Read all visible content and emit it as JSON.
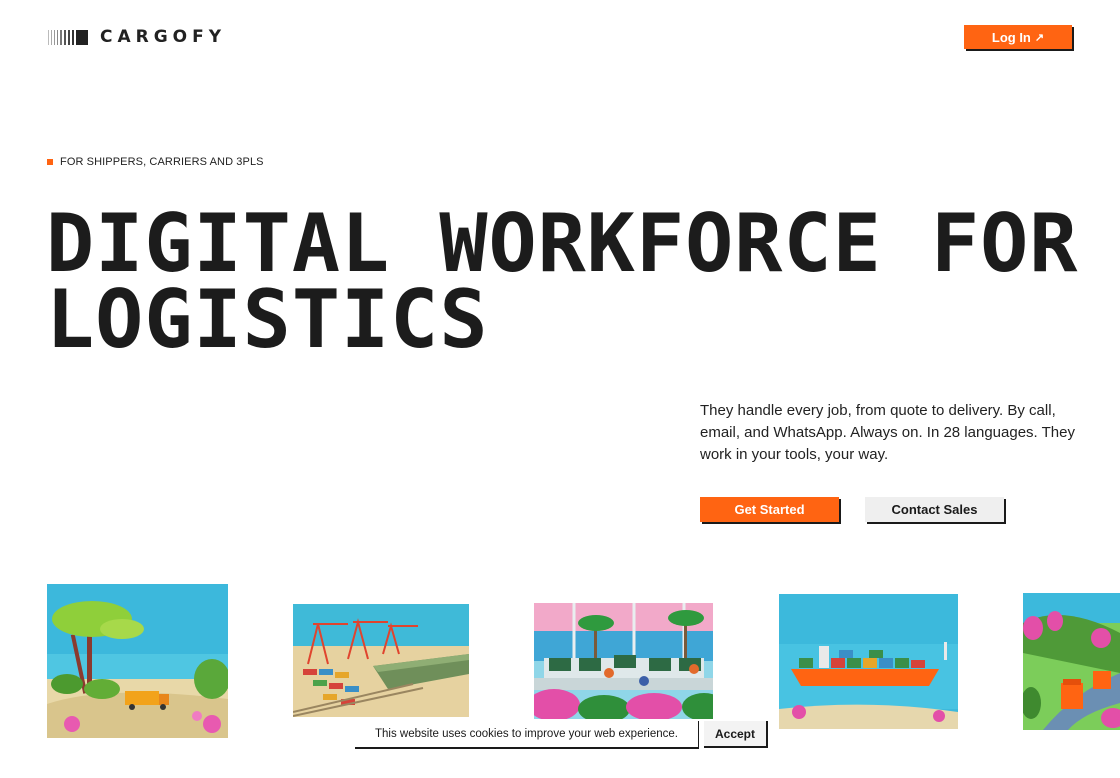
{
  "header": {
    "logo_text": "CARGOFY",
    "login_label": "Log In",
    "login_arrow": "↗"
  },
  "hero": {
    "eyebrow": "FOR SHIPPERS, CARRIERS AND 3PLS",
    "headline_line1": "DIGITAL WORKFORCE FOR",
    "headline_line2": "LOGISTICS",
    "subtext": "They handle every job, from quote to delivery. By call, email, and WhatsApp. Always on. In 28 languages. They work in your tools, your way.",
    "primary_cta": "Get Started",
    "secondary_cta": "Contact Sales"
  },
  "illustrations": [
    {
      "icon": "coastal-road-truck-illustration"
    },
    {
      "icon": "container-port-cranes-illustration"
    },
    {
      "icon": "control-room-operators-illustration"
    },
    {
      "icon": "container-ship-illustration"
    },
    {
      "icon": "mountain-road-trucks-illustration"
    }
  ],
  "cookie": {
    "message": "This website uses cookies to improve your web experience.",
    "accept_label": "Accept"
  },
  "colors": {
    "accent": "#ff6412",
    "text": "#1c1c1c",
    "sky": "#3db9d8"
  }
}
